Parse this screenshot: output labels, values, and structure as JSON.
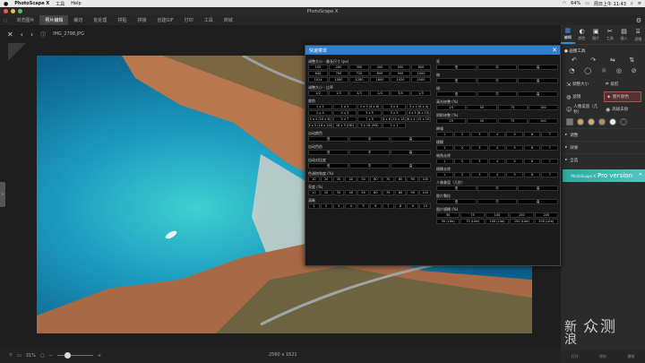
{
  "menubar": {
    "app": "PhotoScape X",
    "items": [
      "工具",
      "Help"
    ],
    "battery": "64%",
    "clock": "周日上午 11:43"
  },
  "titlebar": {
    "title": "PhotoScape X"
  },
  "tabs": [
    "浏览图片",
    "照片编辑",
    "裁切",
    "批处理",
    "拼贴",
    "拼接",
    "创建GIF",
    "打印",
    "工具",
    "商城"
  ],
  "active_tab": 1,
  "viewer": {
    "filename": "IMG_2798.JPG",
    "dimensions": "2560 x 1621",
    "zoom": "31%"
  },
  "right_panel": {
    "tool_tabs": [
      {
        "icon": "▦",
        "label": "编辑"
      },
      {
        "icon": "◐",
        "label": "颜色"
      },
      {
        "icon": "▣",
        "label": "图片"
      },
      {
        "icon": "✂",
        "label": "工具"
      },
      {
        "icon": "▤",
        "label": "插入"
      },
      {
        "icon": "⌸",
        "label": "滤镜"
      }
    ],
    "active_tool_tab": 0,
    "section_basic": "● 画图工具",
    "basic_icons": [
      "↶",
      "↷",
      "⇋",
      "⇅"
    ],
    "tools": [
      {
        "icon": "⇲",
        "label": "调整大小",
        "selected": false
      },
      {
        "icon": "⌗",
        "label": "裁剪",
        "selected": false
      },
      {
        "icon": "◍",
        "label": "滤镜",
        "selected": false
      },
      {
        "icon": "✦",
        "label": "图片颜色",
        "selected": true
      },
      {
        "icon": "☺",
        "label": "人像美容（几秒）",
        "selected": false
      },
      {
        "icon": "◉",
        "label": "高级去除",
        "selected": false
      }
    ],
    "sections_collapsed": [
      "调整",
      "效果",
      "全选"
    ],
    "pro_banner": {
      "small": "PhotoScape X",
      "text": "Pro version"
    },
    "bottom_actions": [
      "打开",
      "保存",
      "撤销"
    ]
  },
  "watermark": {
    "line1": "新",
    "line2": "浪",
    "brand": "众测"
  },
  "dialog": {
    "title": "快速菜单",
    "left": [
      {
        "label": "调整大小 - 最长尺寸 (px)",
        "cols": 6,
        "cells": [
          "100",
          "200",
          "300",
          "400",
          "500",
          "600",
          "640",
          "700",
          "720",
          "800",
          "900",
          "1000",
          "1024",
          "1080",
          "1280",
          "1600",
          "1920",
          "2000"
        ]
      },
      {
        "label": "调整大小 - 比率",
        "cols": 6,
        "cells": [
          "1/2",
          "1/3",
          "2/3",
          "1/4",
          "3/4",
          "1/5"
        ]
      },
      {
        "label": "裁剪",
        "cols": 5,
        "cells": [
          "1 x 2",
          "1 x 1",
          "2 x 3 (4 x 6)",
          "3 x 4",
          "3 x 2 (6 x 4)",
          "2 x 4",
          "4 x 3",
          "3 x 5",
          "5 x 3",
          "4 x 5 (8 x 10)",
          "5 x 4 (10 x 8)",
          "5 x 7",
          "7 x 5",
          "4 x 6 (10 x 15)",
          "6 x 4 (15 x 10)",
          "8 x 5 (16 x 10)",
          "16 x 9 (HD)",
          "9 x 16 (HD)",
          "1 x 1"
        ]
      },
      {
        "label": "自动颜色",
        "cols": 3,
        "cells": [
          "低",
          "中",
          "高"
        ]
      },
      {
        "label": "自动色阶",
        "cols": 3,
        "cells": [
          "低",
          "中",
          "高"
        ]
      },
      {
        "label": "自动对比度",
        "cols": 3,
        "cells": [
          "低",
          "中",
          "高"
        ]
      },
      {
        "label": "色调饱和度 (%)",
        "cols": 10,
        "cells": [
          "10",
          "20",
          "30",
          "40",
          "50",
          "60",
          "70",
          "80",
          "90",
          "100"
        ]
      },
      {
        "label": "亮度 (%)",
        "cols": 10,
        "cells": [
          "10",
          "20",
          "30",
          "40",
          "50",
          "60",
          "70",
          "80",
          "90",
          "100"
        ]
      },
      {
        "label": "清晰",
        "cols": 10,
        "cells": [
          "1",
          "2",
          "3",
          "4",
          "5",
          "6",
          "7",
          "8",
          "9",
          "10"
        ]
      }
    ],
    "right": [
      {
        "label": "亮",
        "cols": 3,
        "cells": [
          "低",
          "中",
          "高"
        ]
      },
      {
        "label": "暗",
        "cols": 3,
        "cells": [
          "低",
          "中",
          "高"
        ]
      },
      {
        "label": "锐",
        "cols": 3,
        "cells": [
          "低",
          "中",
          "高"
        ]
      },
      {
        "label": "高光修整 (%)",
        "cols": 4,
        "cells": [
          "25",
          "50",
          "75",
          "100"
        ]
      },
      {
        "label": "阴影修整 (%)",
        "cols": 4,
        "cells": [
          "25",
          "50",
          "75",
          "100"
        ]
      },
      {
        "label": "降噪",
        "cols": 7,
        "cells": [
          "1",
          "2",
          "3",
          "4",
          "5",
          "6",
          "7"
        ]
      },
      {
        "label": "模糊",
        "cols": 7,
        "cells": [
          "1",
          "2",
          "3",
          "4",
          "5",
          "6",
          "7"
        ]
      },
      {
        "label": "暗角去除",
        "cols": 7,
        "cells": [
          "1",
          "2",
          "3",
          "4",
          "5",
          "6",
          "7"
        ]
      },
      {
        "label": "模糊去除",
        "cols": 7,
        "cells": [
          "1",
          "2",
          "3",
          "4",
          "5",
          "6",
          "7"
        ]
      },
      {
        "label": "人像美容（几秒）",
        "cols": 3,
        "cells": [
          "低",
          "中",
          "高"
        ]
      },
      {
        "label": "胶片颗粒",
        "cols": 3,
        "cells": [
          "低",
          "中",
          "高"
        ]
      },
      {
        "label": "图片模糊 (%)",
        "cols": 5,
        "cells": [
          "50",
          "75",
          "100",
          "150",
          "200",
          "50 (Lite)",
          "75 (Lite)",
          "100 (Lite)",
          "150 (Lite)",
          "200 (Lite)"
        ]
      }
    ]
  }
}
